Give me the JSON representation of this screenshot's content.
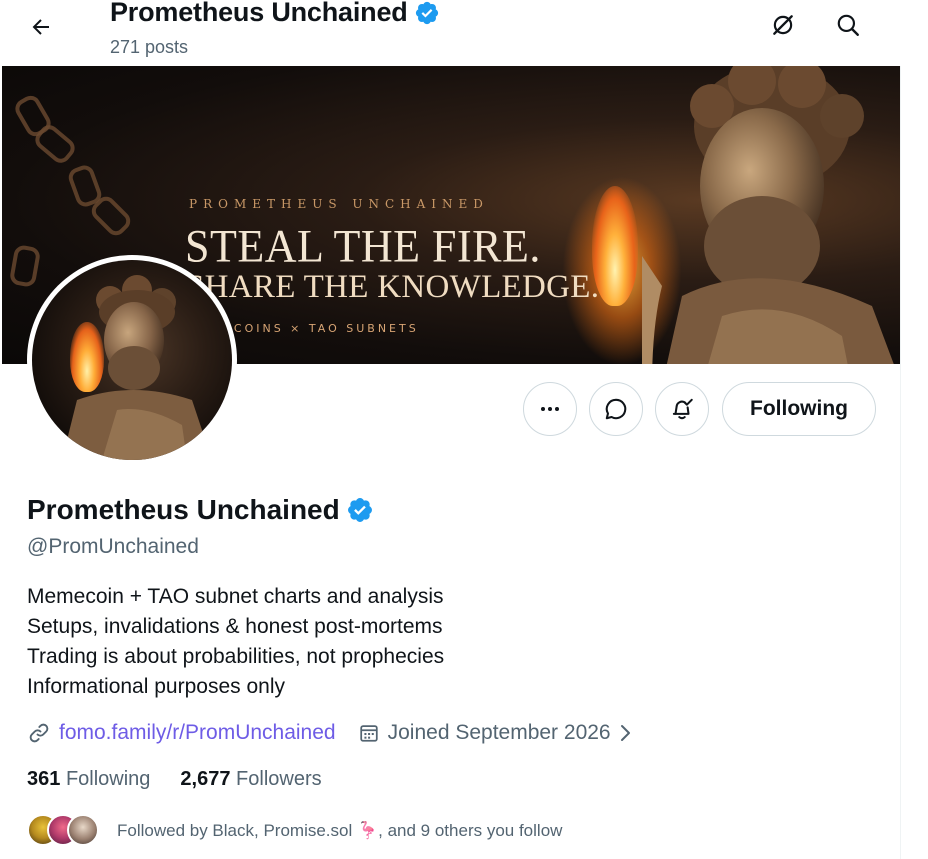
{
  "header": {
    "title": "Prometheus Unchained",
    "post_count": "271 posts",
    "back_icon": "arrow-left-icon",
    "grok_icon": "grok-icon",
    "search_icon": "search-icon"
  },
  "banner": {
    "kicker": "PROMETHEUS UNCHAINED",
    "headline_1": "STEAL THE FIRE.",
    "headline_2": "SHARE THE KNOWLEDGE.",
    "tagline": "MEMECOINS × TAO SUBNETS"
  },
  "actions": {
    "more_icon": "more-icon",
    "message_icon": "message-icon",
    "notify_icon": "bell-check-icon",
    "follow_label": "Following"
  },
  "profile": {
    "name": "Prometheus Unchained",
    "handle": "@PromUnchained",
    "bio": [
      "Memecoin + TAO subnet charts and analysis",
      "Setups, invalidations & honest post-mortems",
      "Trading is about probabilities, not prophecies",
      "Informational purposes only"
    ],
    "link": "fomo.family/r/PromUnchained",
    "joined": "Joined September 2026"
  },
  "stats": {
    "following_count": "361",
    "following_label": "Following",
    "followers_count": "2,677",
    "followers_label": "Followers"
  },
  "followed_by": "Followed by Black, Promise.sol 🦩, and 9 others you follow",
  "colors": {
    "verified": "#1d9bf0",
    "link": "#6e5ce6",
    "muted": "#536471",
    "text": "#0f1419"
  }
}
